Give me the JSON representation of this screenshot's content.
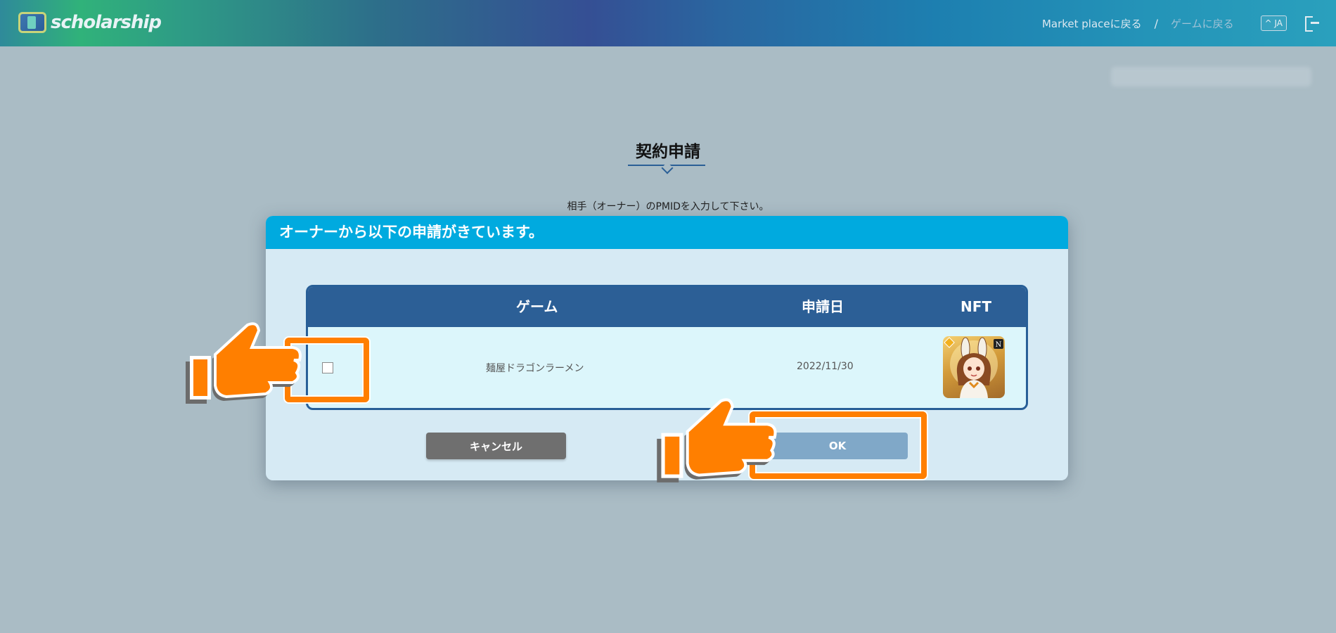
{
  "header": {
    "logo_text": "scholarship",
    "nav": {
      "marketplace_label": "Market placeに戻る",
      "separator": "/",
      "game_label": "ゲームに戻る",
      "lang_label": "^ JA"
    }
  },
  "page": {
    "title": "契約申請",
    "instruction": "相手（オーナー）のPMIDを入力して下さい。"
  },
  "modal": {
    "title": "オーナーから以下の申請がきています。",
    "table": {
      "headers": {
        "game": "ゲーム",
        "date": "申請日",
        "nft": "NFT"
      },
      "rows": [
        {
          "checked": false,
          "game": "麺屋ドラゴンラーメン",
          "date": "2022/11/30",
          "nft_badge": "N"
        }
      ]
    },
    "cancel_label": "キャンセル",
    "ok_label": "OK"
  },
  "colors": {
    "header_gradient_mid": "#354f94",
    "modal_header": "#00aadf",
    "table_header": "#2c5f96",
    "highlight": "#ff7f00",
    "cancel_button": "#6f6f6f",
    "ok_button": "#80a8c8"
  }
}
